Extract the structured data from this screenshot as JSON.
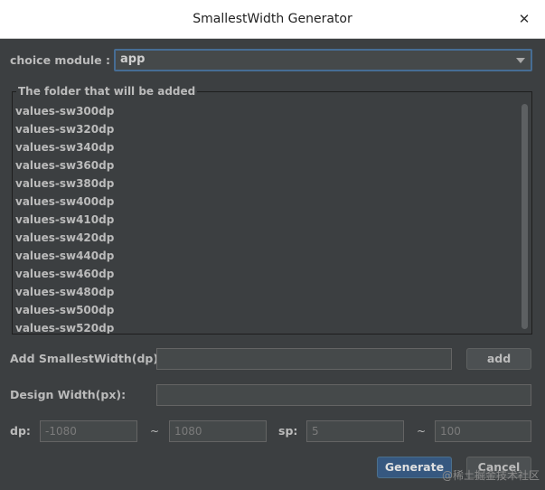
{
  "window": {
    "title": "SmallestWidth Generator",
    "close_glyph": "✕"
  },
  "module": {
    "label": "choice module :",
    "selected": "app"
  },
  "folders": {
    "title": "The folder that will be added",
    "items": [
      "values-sw300dp",
      "values-sw320dp",
      "values-sw340dp",
      "values-sw360dp",
      "values-sw380dp",
      "values-sw400dp",
      "values-sw410dp",
      "values-sw420dp",
      "values-sw440dp",
      "values-sw460dp",
      "values-sw480dp",
      "values-sw500dp",
      "values-sw520dp"
    ]
  },
  "add_sw": {
    "label": "Add SmallestWidth(dp):",
    "value": "",
    "button": "add"
  },
  "design": {
    "label": "Design Width(px):",
    "value": ""
  },
  "range": {
    "dp_label": "dp:",
    "dp_min": "-1080",
    "dp_max": "1080",
    "tilde": "~",
    "sp_label": "sp:",
    "sp_min": "5",
    "sp_max": "100"
  },
  "actions": {
    "generate": "Generate",
    "cancel": "Cancel"
  },
  "watermark": "@稀土掘金技术社区"
}
